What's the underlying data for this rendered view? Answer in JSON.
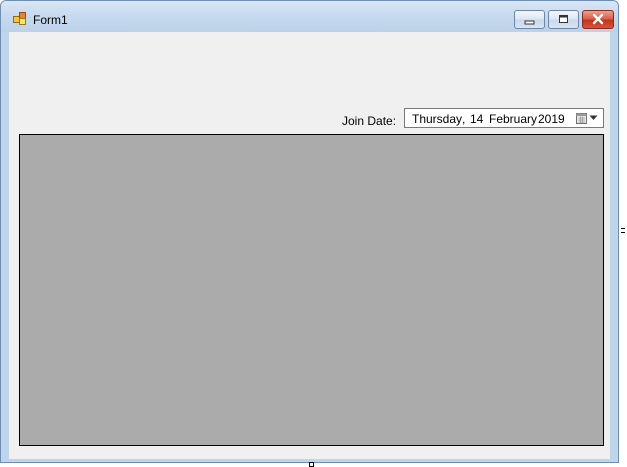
{
  "window": {
    "title": "Form1"
  },
  "titlebar_buttons": {
    "minimize_icon": "minimize-icon",
    "maximize_icon": "maximize-icon",
    "close_icon": "close-icon"
  },
  "form": {
    "join_label": "Join Date:",
    "date_picker": {
      "weekday": "Thursday",
      "separator": ",",
      "day": "14",
      "month": "February",
      "year": "2019",
      "calendar_icon": "calendar-icon",
      "dropdown_icon": "chevron-down-icon"
    }
  },
  "colors": {
    "client_background": "#f0f0f0",
    "panel_background": "#ababab",
    "close_button": "#c2341c"
  }
}
